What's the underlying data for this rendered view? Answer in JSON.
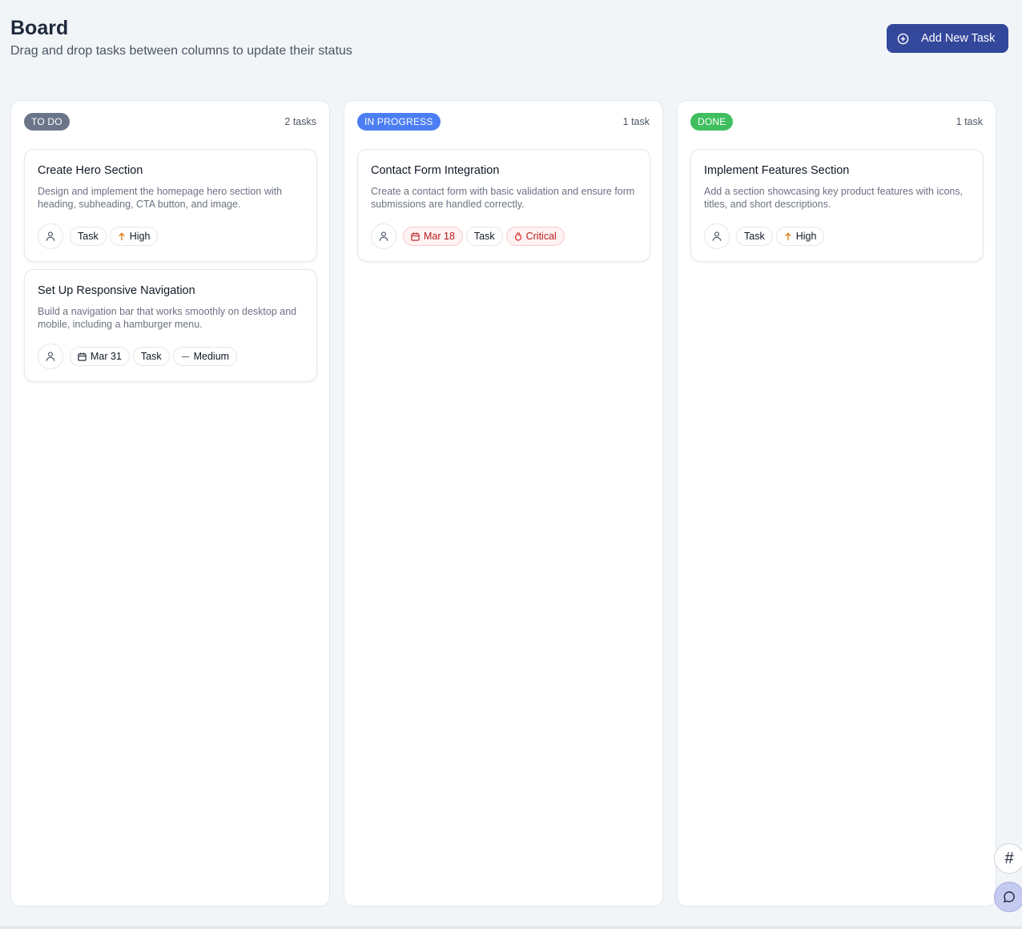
{
  "header": {
    "title": "Board",
    "subtitle": "Drag and drop tasks between columns to update their status",
    "add_button_label": "Add New Task"
  },
  "columns": [
    {
      "label": "TO DO",
      "color": "#6b7589",
      "count": "2 tasks",
      "cards": [
        {
          "title": "Create Hero Section",
          "description": "Design and implement the homepage hero section with heading, subheading, CTA button, and image.",
          "type": "Task",
          "priority": "High",
          "priority_icon": "arrow-up-icon"
        },
        {
          "title": "Set Up Responsive Navigation",
          "description": "Build a navigation bar that works smoothly on desktop and mobile, including a hamburger menu.",
          "due_date": "Mar 31",
          "type": "Task",
          "priority": "Medium",
          "priority_icon": "minus-icon"
        }
      ]
    },
    {
      "label": "IN PROGRESS",
      "color": "#4c7ef3",
      "count": "1 task",
      "cards": [
        {
          "title": "Contact Form Integration",
          "description": "Create a contact form with basic validation and ensure form submissions are handled correctly.",
          "due_date": "Mar 18",
          "type": "Task",
          "priority": "Critical",
          "priority_icon": "flame-icon"
        }
      ]
    },
    {
      "label": "DONE",
      "color": "#3fbf5f",
      "count": "1 task",
      "cards": [
        {
          "title": "Implement Features Section",
          "description": "Add a section showcasing key product features with icons, titles, and short descriptions.",
          "type": "Task",
          "priority": "High",
          "priority_icon": "arrow-up-icon"
        }
      ]
    }
  ],
  "floating": {
    "hash_label": "#"
  }
}
